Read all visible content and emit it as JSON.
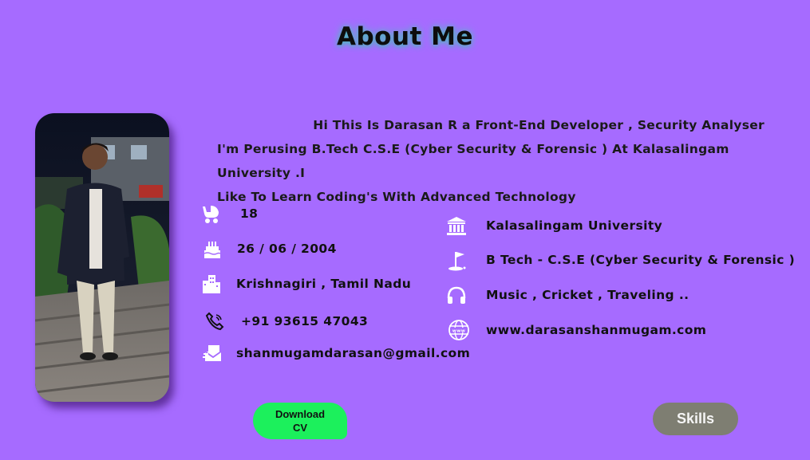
{
  "header": {
    "title": "About Me"
  },
  "intro": {
    "line1": "Hi This Is Darasan R a Front-End Developer , Security Analyser",
    "line2": "I'm Perusing B.Tech C.S.E (Cyber  Security & Forensic ) At Kalasalingam University .I",
    "line3": "Like To Learn Coding's  With Advanced Technology"
  },
  "left_info": {
    "age": "18",
    "dob": "26 / 06 / 2004",
    "location": "Krishnagiri , Tamil Nadu",
    "phone": "+91 93615 47043",
    "email": "shanmugamdarasan@gmail.com"
  },
  "right_info": {
    "university": "Kalasalingam University",
    "degree": "B Tech - C.S.E (Cyber Security &  Forensic )",
    "hobbies": "Music , Cricket , Traveling ..",
    "website": "www.darasanshanmugam.com"
  },
  "icons": {
    "age": "baby-carriage-icon",
    "dob": "birthday-cake-icon",
    "location": "city-buildings-icon",
    "phone": "phone-icon",
    "email": "mail-icon",
    "university": "university-building-icon",
    "degree": "graduation-flag-icon",
    "hobbies": "headphones-icon",
    "website": "globe-www-icon"
  },
  "buttons": {
    "download_cv": "Download CV",
    "skills": "Skills"
  },
  "colors": {
    "background": "#a66bff",
    "cv_button": "#1cf05c",
    "skills_button": "#7e7e72"
  }
}
